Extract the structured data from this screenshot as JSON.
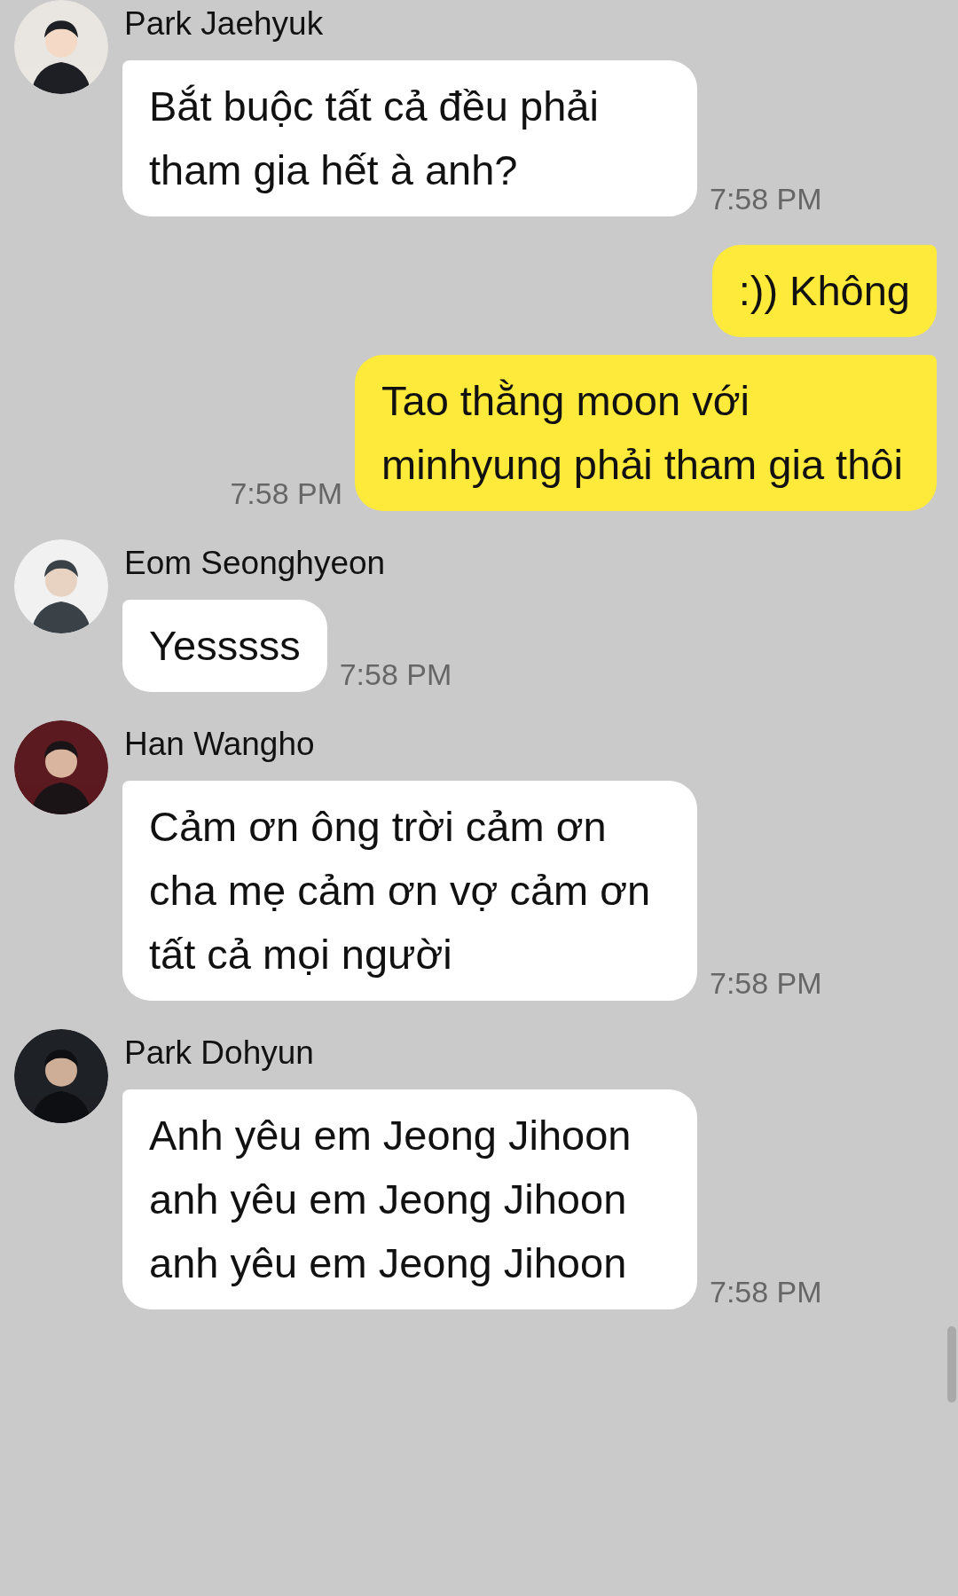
{
  "messages": [
    {
      "kind": "received",
      "sender": "Park Jaehyuk",
      "text": "Bắt buộc tất cả đều phải tham gia hết à anh?",
      "time": "7:58 PM"
    },
    {
      "kind": "sent",
      "text": ":)) Không"
    },
    {
      "kind": "sent",
      "text": "Tao thằng moon với minhyung phải tham gia thôi",
      "time": "7:58 PM"
    },
    {
      "kind": "received",
      "sender": "Eom Seonghyeon",
      "text": "Yesssss",
      "time": "7:58 PM"
    },
    {
      "kind": "received",
      "sender": "Han Wangho",
      "text": "Cảm ơn ông trời cảm ơn cha mẹ cảm ơn vợ cảm ơn tất cả mọi người",
      "time": "7:58 PM"
    },
    {
      "kind": "received",
      "sender": "Park Dohyun",
      "text": "Anh yêu em Jeong Jihoon anh yêu em Jeong Jihoon anh yêu em Jeong Jihoon",
      "time": "7:58 PM"
    }
  ]
}
